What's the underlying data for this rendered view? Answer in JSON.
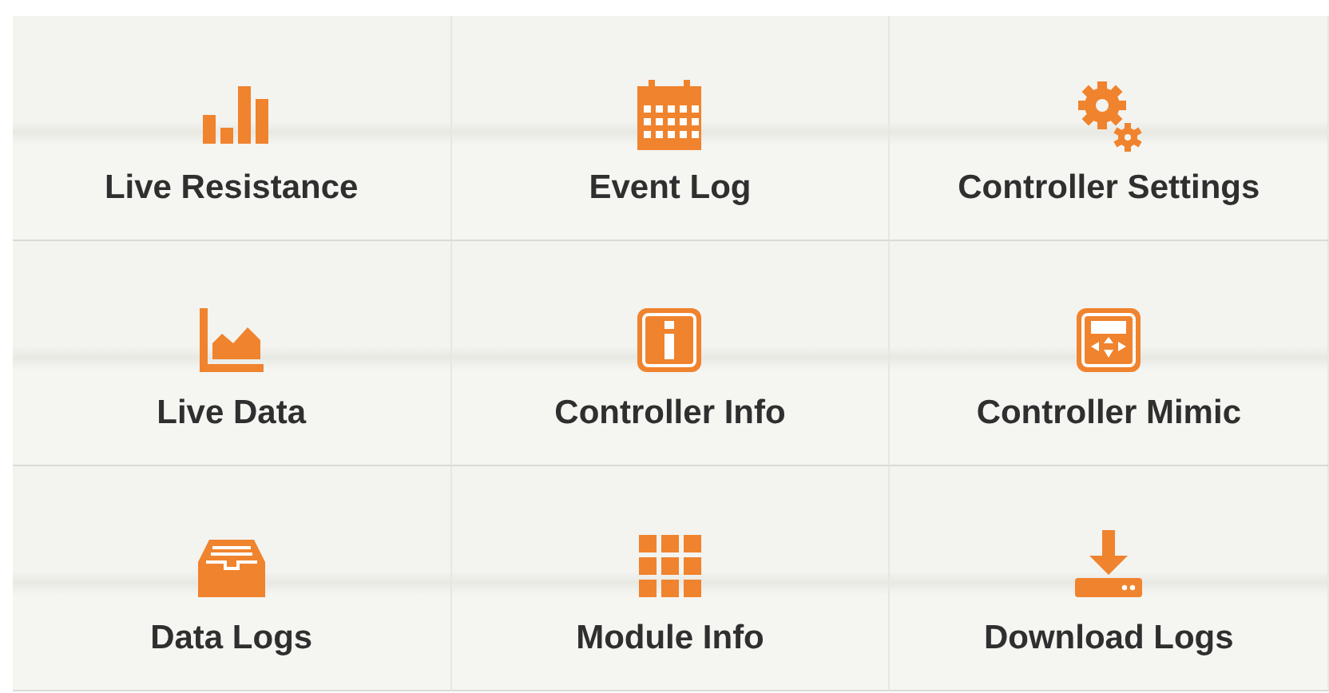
{
  "tiles": [
    {
      "label": "Live Resistance"
    },
    {
      "label": "Event Log"
    },
    {
      "label": "Controller Settings"
    },
    {
      "label": "Live Data"
    },
    {
      "label": "Controller Info"
    },
    {
      "label": "Controller Mimic"
    },
    {
      "label": "Data Logs"
    },
    {
      "label": "Module Info"
    },
    {
      "label": "Download Logs"
    }
  ]
}
